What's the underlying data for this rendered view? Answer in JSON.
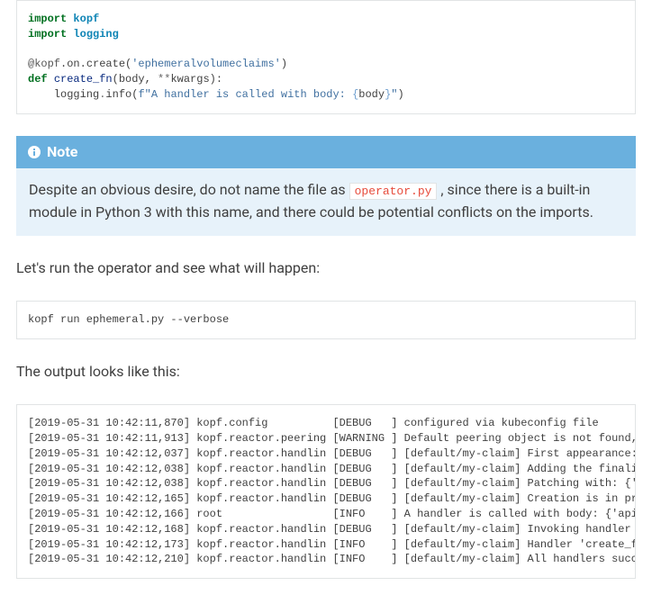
{
  "code_python": {
    "line1_kw": "import",
    "line1_mod": "kopf",
    "line2_kw": "import",
    "line2_mod": "logging",
    "deco_at": "@kopf",
    "deco_rest": ".on.create(",
    "deco_str": "'ephemeralvolumeclaims'",
    "deco_close": ")",
    "def_kw": "def",
    "def_name": "create_fn",
    "def_sig_open": "(body, ",
    "def_sig_kwargs_stars": "**",
    "def_sig_kwargs_name": "kwargs):",
    "body_indent": "    logging",
    "body_dot": ".",
    "body_call": "info(",
    "body_fprefix": "f\"A handler is called with body: ",
    "body_interp_open": "{",
    "body_interp_var": "body",
    "body_interp_close": "}",
    "body_str_close": "\"",
    "body_paren_close": ")"
  },
  "note": {
    "title": "Note",
    "text_before": "Despite an obvious desire, do not name the file as ",
    "code": "operator.py",
    "text_after": " , since there is a built-in module in Python 3 with this name, and there could be potential conflicts on the imports."
  },
  "para1": "Let's run the operator and see what will happen:",
  "code_shell": "kopf run ephemeral.py --verbose",
  "para2": "The output looks like this:",
  "log_lines": [
    "[2019-05-31 10:42:11,870] kopf.config          [DEBUG   ] configured via kubeconfig file",
    "[2019-05-31 10:42:11,913] kopf.reactor.peering [WARNING ] Default peering object is not found, falling b",
    "[2019-05-31 10:42:12,037] kopf.reactor.handlin [DEBUG   ] [default/my-claim] First appearance: {'apiVers",
    "[2019-05-31 10:42:12,038] kopf.reactor.handlin [DEBUG   ] [default/my-claim] Adding the finalizer, thus ",
    "[2019-05-31 10:42:12,038] kopf.reactor.handlin [DEBUG   ] [default/my-claim] Patching with: {'metadata':",
    "[2019-05-31 10:42:12,165] kopf.reactor.handlin [DEBUG   ] [default/my-claim] Creation is in progress: {'",
    "[2019-05-31 10:42:12,166] root                 [INFO    ] A handler is called with body: {'apiVersion': ",
    "[2019-05-31 10:42:12,168] kopf.reactor.handlin [DEBUG   ] [default/my-claim] Invoking handler 'create_fn",
    "[2019-05-31 10:42:12,173] kopf.reactor.handlin [INFO    ] [default/my-claim] Handler 'create_fn' succeed",
    "[2019-05-31 10:42:12,210] kopf.reactor.handlin [INFO    ] [default/my-claim] All handlers succeeded for "
  ]
}
